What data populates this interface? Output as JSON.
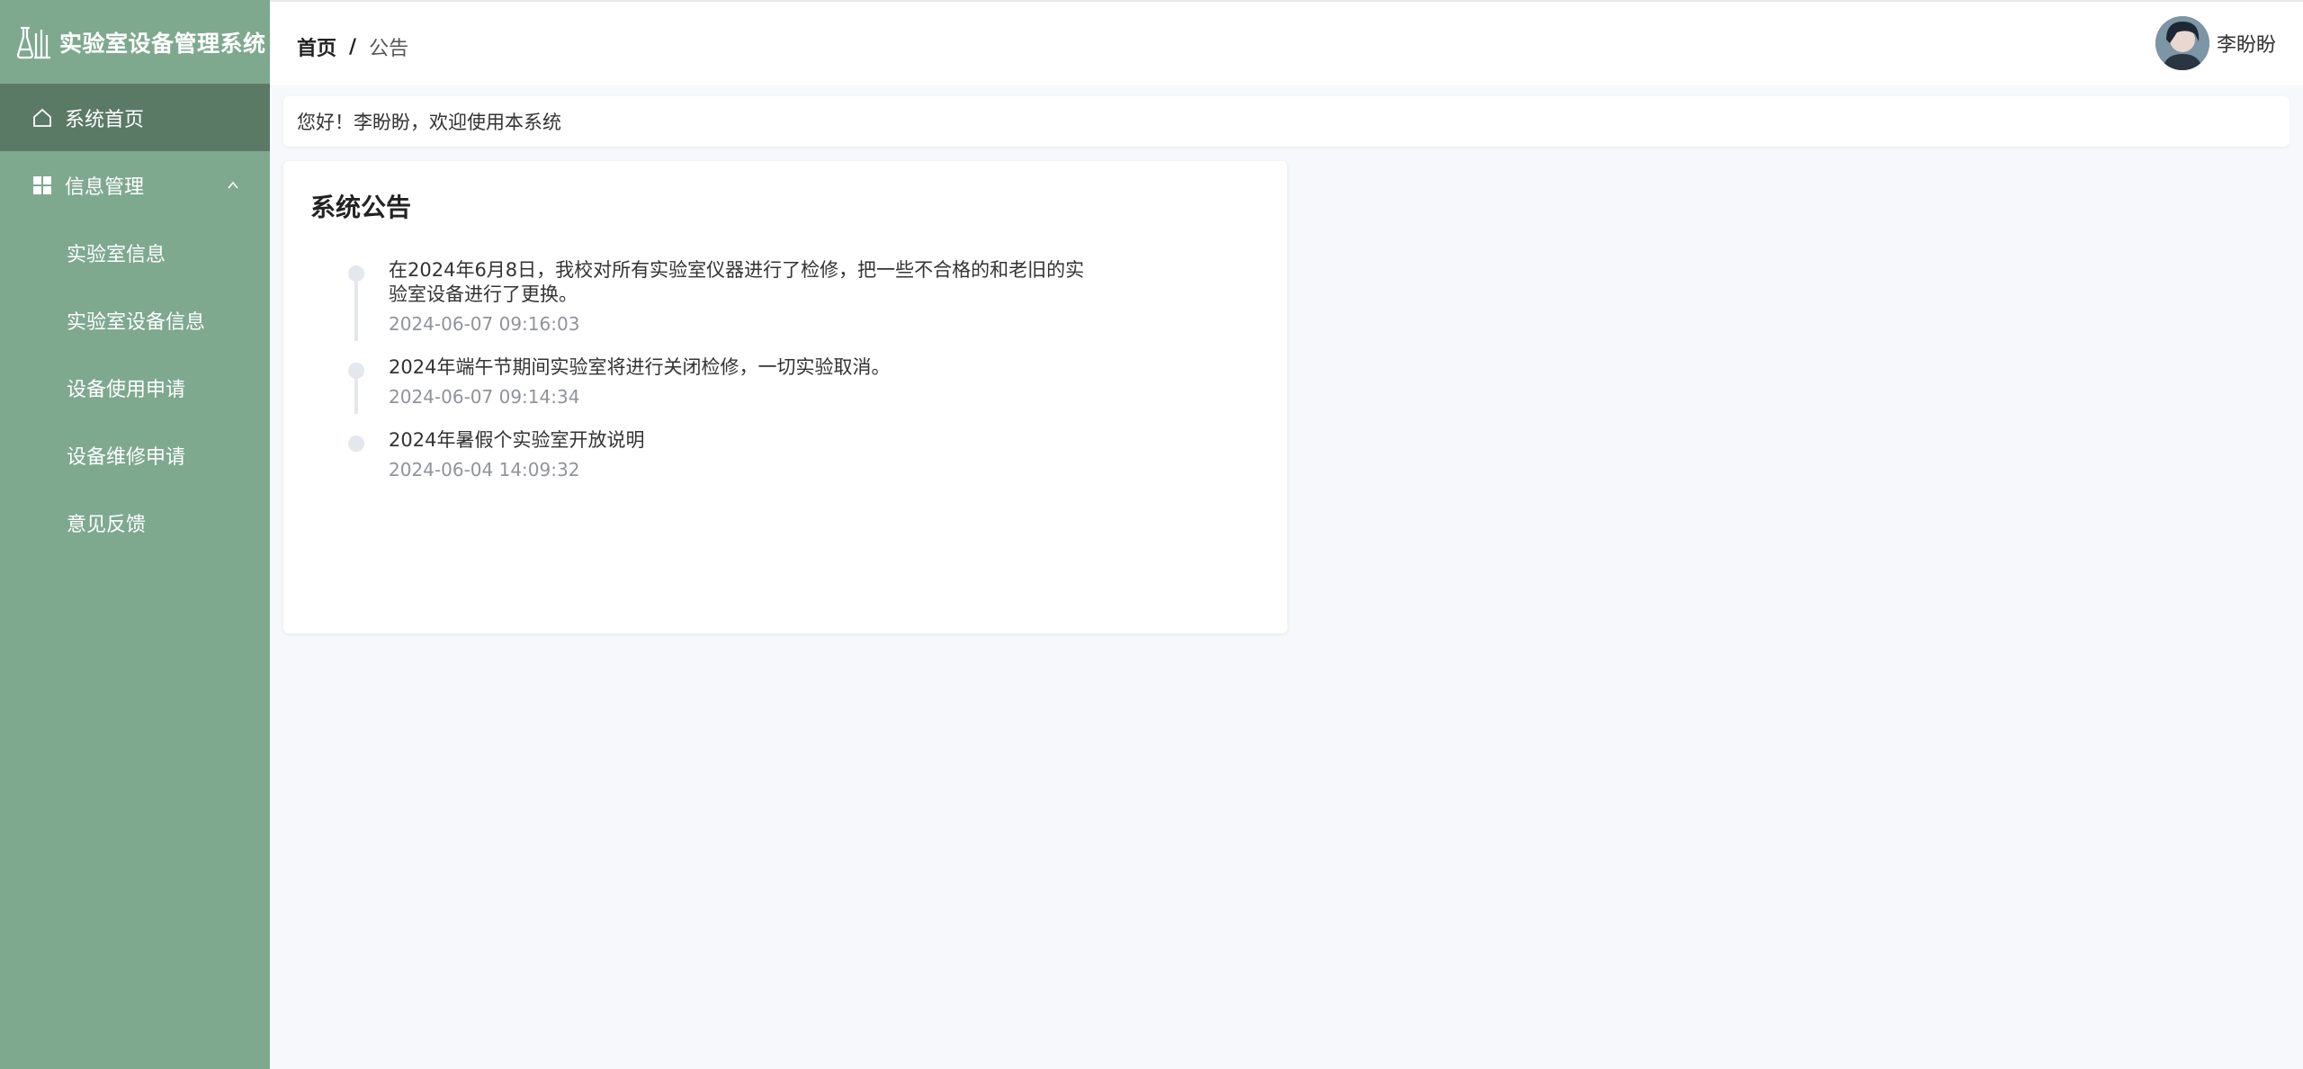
{
  "sidebar": {
    "app_title": "实验室设备管理系统",
    "items": [
      {
        "label": "系统首页",
        "icon": "home-icon",
        "active": true
      },
      {
        "label": "信息管理",
        "icon": "grid-icon",
        "expanded": true
      }
    ],
    "sub_items": [
      {
        "label": "实验室信息"
      },
      {
        "label": "实验室设备信息"
      },
      {
        "label": "设备使用申请"
      },
      {
        "label": "设备维修申请"
      },
      {
        "label": "意见反馈"
      }
    ],
    "colors": {
      "background": "#7ea98f",
      "active": "#5b7a66"
    }
  },
  "header": {
    "breadcrumb_home": "首页",
    "breadcrumb_sep": "/",
    "breadcrumb_current": "公告",
    "username": "李盼盼"
  },
  "welcome": {
    "text": "您好！李盼盼，欢迎使用本系统"
  },
  "notices": {
    "title": "系统公告",
    "items": [
      {
        "content": "在2024年6月8日，我校对所有实验室仪器进行了检修，把一些不合格的和老旧的实验室设备进行了更换。",
        "time": "2024-06-07 09:16:03"
      },
      {
        "content": "2024年端午节期间实验室将进行关闭检修，一切实验取消。",
        "time": "2024-06-07 09:14:34"
      },
      {
        "content": "2024年暑假个实验室开放说明",
        "time": "2024-06-04 14:09:32"
      }
    ]
  }
}
